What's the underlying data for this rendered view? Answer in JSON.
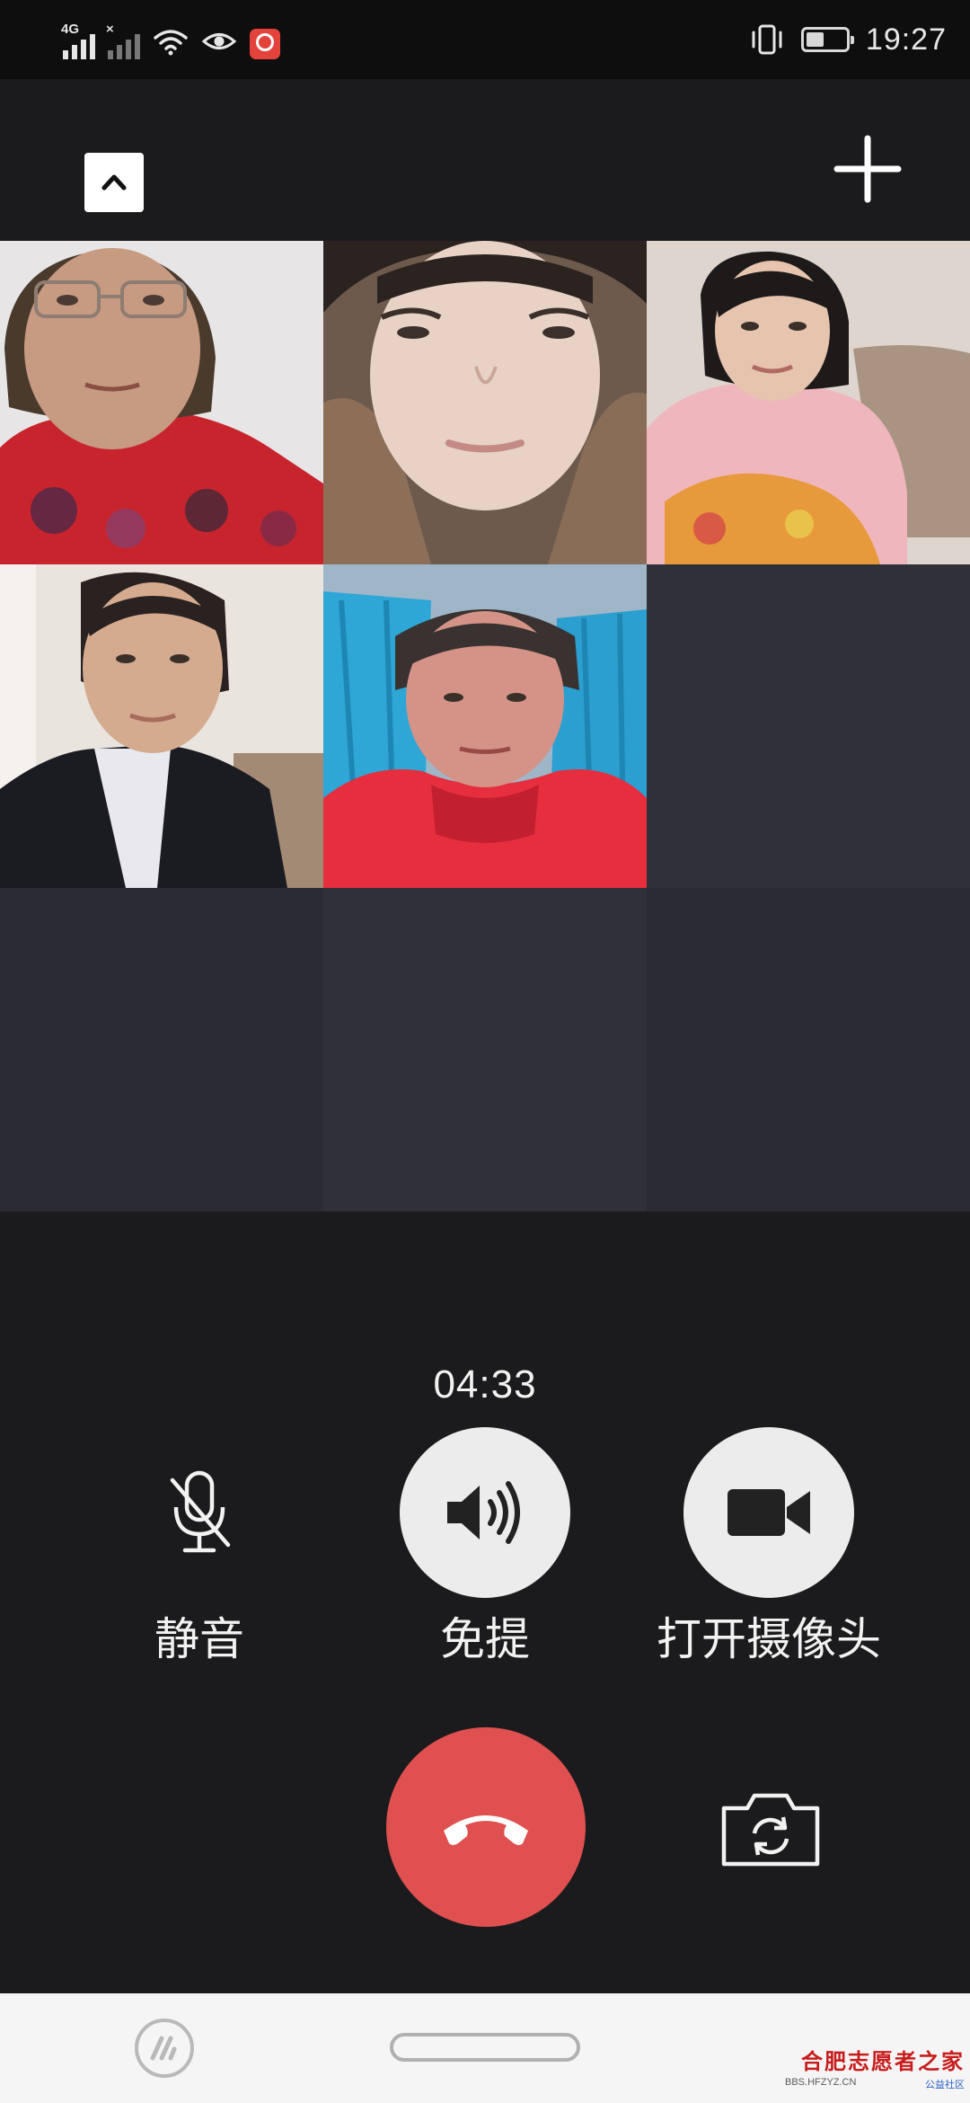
{
  "status_bar": {
    "network_label": "4G",
    "time": "19:27",
    "battery_level": 0.45
  },
  "call": {
    "duration": "04:33",
    "participants_shown": 5,
    "empty_slots": 4
  },
  "controls": {
    "mute_label": "静音",
    "speaker_label": "免提",
    "camera_label": "打开摄像头"
  },
  "watermark": {
    "title": "合肥志愿者之家",
    "site": "BBS.HFZYZ.CN",
    "tag": "公益社区"
  },
  "colors": {
    "background": "#1b1b1d",
    "empty_tile": "#2f3038",
    "hangup": "#e05050",
    "control_active": "#ececec"
  }
}
